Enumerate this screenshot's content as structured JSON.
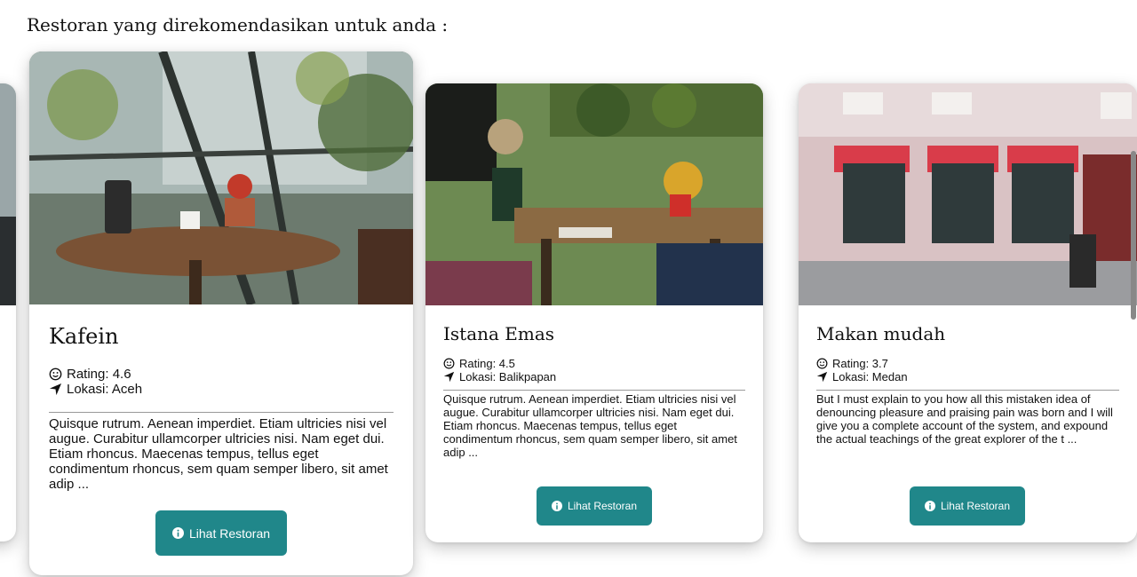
{
  "heading": "Restoran yang direkomendasikan untuk anda :",
  "colors": {
    "button": "#20878a",
    "divider": "#999999"
  },
  "icons": {
    "rating": "smile-icon",
    "location": "location-arrow-icon",
    "button": "info-circle-icon"
  },
  "cards": [
    {
      "name": "Kafein",
      "rating": "Rating: 4.6",
      "location": "Lokasi: Aceh",
      "description": "Quisque rutrum. Aenean imperdiet. Etiam ultricies nisi vel augue. Curabitur ullamcorper ultricies nisi. Nam eget dui. Etiam rhoncus. Maecenas tempus, tellus eget condimentum rhoncus, sem quam semper libero, sit amet adip ...",
      "button": "Lihat Restoran"
    },
    {
      "name": "Istana Emas",
      "rating": "Rating: 4.5",
      "location": "Lokasi: Balikpapan",
      "description": "Quisque rutrum. Aenean imperdiet. Etiam ultricies nisi vel augue. Curabitur ullamcorper ultricies nisi. Nam eget dui. Etiam rhoncus. Maecenas tempus, tellus eget condimentum rhoncus, sem quam semper libero, sit amet adip ...",
      "button": "Lihat Restoran"
    },
    {
      "name": "Makan mudah",
      "rating": "Rating: 3.7",
      "location": "Lokasi: Medan",
      "description": "But I must explain to you how all this mistaken idea of denouncing pleasure and praising pain was born and I will give you a complete account of the system, and expound the actual teachings of the great explorer of the t ...",
      "button": "Lihat Restoran"
    }
  ]
}
